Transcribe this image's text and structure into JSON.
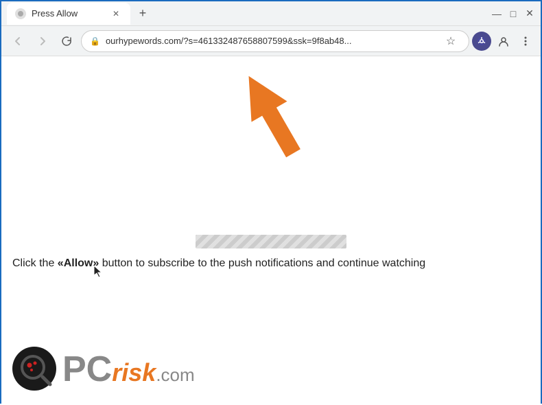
{
  "window": {
    "title": "Press Allow",
    "url": "ourhypewords.com/?s=461332487658807599&ssk=9f8ab48...",
    "url_display": "ourhypewords.com/?s=461332487658807599&ssk=9f8ab48..."
  },
  "nav": {
    "back_label": "←",
    "forward_label": "→",
    "close_label": "✕",
    "new_tab_label": "+"
  },
  "window_controls": {
    "minimize": "—",
    "maximize": "□",
    "close": "✕"
  },
  "content": {
    "instruction": "Click the «Allow» button to subscribe to the push notifications and continue watching",
    "instruction_prefix": "Click the ",
    "instruction_bold": "«Allow»",
    "instruction_suffix": " button to subscribe to the push notifications and continue watching"
  },
  "watermark": {
    "pc_text": "PC",
    "risk_text": "risk",
    "dot_com": ".com"
  }
}
